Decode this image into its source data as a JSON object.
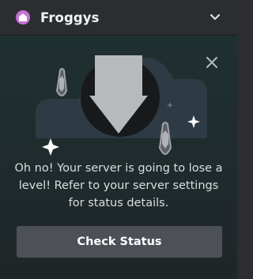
{
  "header": {
    "server_name": "Froggys"
  },
  "notice": {
    "message": "Oh no! Your server is going to lose a level! Refer to your server settings for status details.",
    "cta_label": "Check Status"
  }
}
